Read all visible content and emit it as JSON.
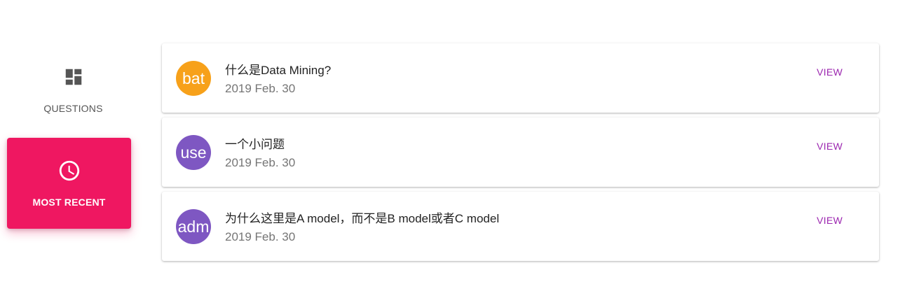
{
  "nav": {
    "items": [
      {
        "label": "QUESTIONS",
        "icon": "dashboard-icon",
        "active": false
      },
      {
        "label": "MOST RECENT",
        "icon": "clock-icon",
        "active": true
      }
    ],
    "active_color": "#ef1761"
  },
  "questions": [
    {
      "avatar_text": "bat",
      "avatar_color": "#f7a11a",
      "title": "什么是Data Mining?",
      "date": "2019 Feb. 30",
      "action_label": "VIEW"
    },
    {
      "avatar_text": "use",
      "avatar_color": "#7e57c2",
      "title": "一个小问题",
      "date": "2019 Feb. 30",
      "action_label": "VIEW"
    },
    {
      "avatar_text": "adm",
      "avatar_color": "#7e57c2",
      "title": "为什么这里是A model，而不是B model或者C model",
      "date": "2019 Feb. 30",
      "action_label": "VIEW"
    }
  ],
  "colors": {
    "action": "#9c27b0"
  }
}
